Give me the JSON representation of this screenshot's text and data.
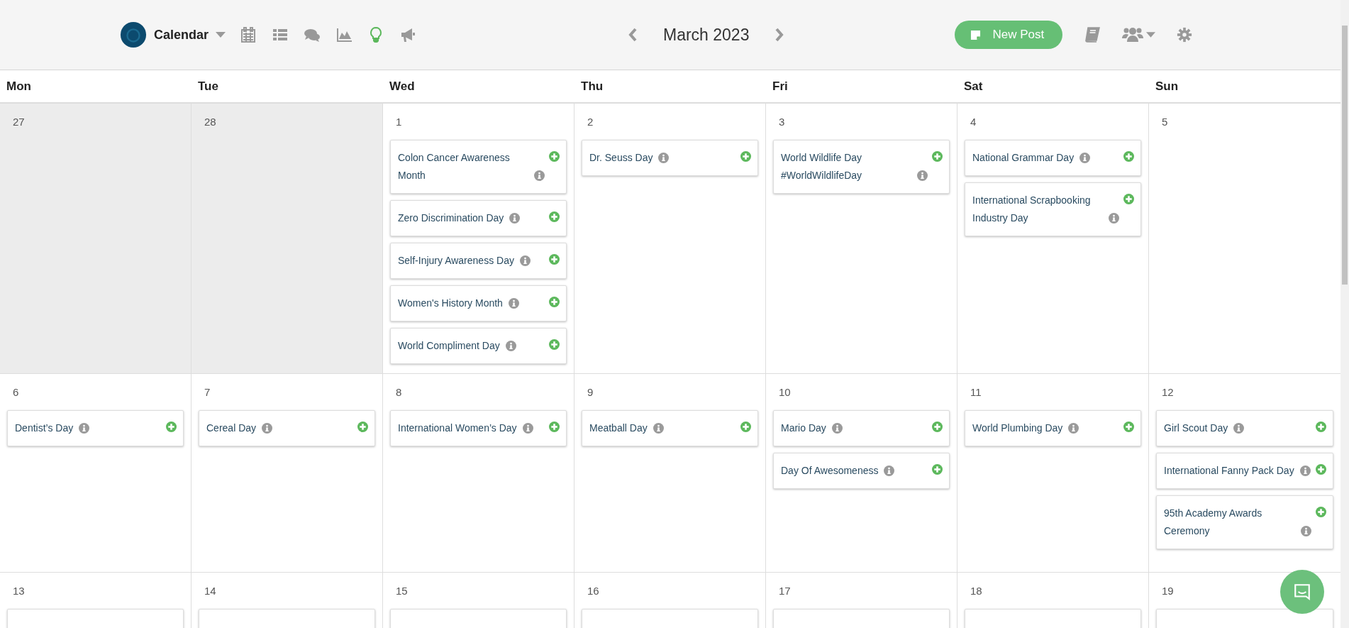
{
  "header": {
    "brand": {
      "label": "Calendar"
    },
    "views": [
      {
        "kind": "calendar",
        "selected": false
      },
      {
        "kind": "list",
        "selected": false
      },
      {
        "kind": "comments",
        "selected": false
      },
      {
        "kind": "chart",
        "selected": false
      },
      {
        "kind": "ideas",
        "selected": true
      },
      {
        "kind": "campaigns",
        "selected": false
      }
    ],
    "month": "March 2023",
    "new_post": "New Post"
  },
  "weekdays": [
    "Mon",
    "Tue",
    "Wed",
    "Thu",
    "Fri",
    "Sat",
    "Sun"
  ],
  "weeks": [
    [
      {
        "day": "27",
        "other_month": true
      },
      {
        "day": "28",
        "other_month": true
      },
      {
        "day": "1",
        "other_month": false,
        "events": [
          {
            "kind": "full",
            "title": "Colon Cancer Awareness Month"
          },
          {
            "kind": "full",
            "title": "Zero Discrimination Day"
          },
          {
            "kind": "full",
            "title": "Self-Injury Awareness Day"
          },
          {
            "kind": "full",
            "title": "Women's History Month"
          },
          {
            "kind": "full",
            "title": "World Compliment Day"
          }
        ]
      },
      {
        "day": "2",
        "other_month": false,
        "events": [
          {
            "kind": "full",
            "title": "Dr. Seuss Day"
          }
        ]
      },
      {
        "day": "3",
        "other_month": false,
        "events": [
          {
            "kind": "full",
            "title": "World Wildlife Day #WorldWildlifeDay"
          }
        ]
      },
      {
        "day": "4",
        "other_month": false,
        "events": [
          {
            "kind": "full",
            "title": "National Grammar Day"
          },
          {
            "kind": "full",
            "title": "International Scrapbooking Industry Day"
          }
        ]
      },
      {
        "day": "5",
        "other_month": false
      }
    ],
    [
      {
        "day": "6",
        "other_month": false,
        "events": [
          {
            "kind": "full",
            "title": "Dentist’s Day"
          }
        ]
      },
      {
        "day": "7",
        "other_month": false,
        "events": [
          {
            "kind": "full",
            "title": "Cereal Day"
          }
        ]
      },
      {
        "day": "8",
        "other_month": false,
        "events": [
          {
            "kind": "full",
            "title": "International Women’s Day"
          }
        ]
      },
      {
        "day": "9",
        "other_month": false,
        "events": [
          {
            "kind": "full",
            "title": "Meatball Day"
          }
        ]
      },
      {
        "day": "10",
        "other_month": false,
        "events": [
          {
            "kind": "full",
            "title": "Mario Day"
          },
          {
            "kind": "full",
            "title": "Day Of Awesomeness"
          }
        ]
      },
      {
        "day": "11",
        "other_month": false,
        "events": [
          {
            "kind": "full",
            "title": "World Plumbing Day"
          }
        ]
      },
      {
        "day": "12",
        "other_month": false,
        "events": [
          {
            "kind": "full",
            "title": "Girl Scout Day"
          },
          {
            "kind": "full",
            "title": "International Fanny Pack Day"
          },
          {
            "kind": "full",
            "title": "95th Academy Awards Ceremony"
          }
        ]
      }
    ],
    [
      {
        "day": "13",
        "other_month": false,
        "events": [
          {
            "kind": "cut"
          }
        ]
      },
      {
        "day": "14",
        "other_month": false,
        "events": [
          {
            "kind": "cut"
          }
        ]
      },
      {
        "day": "15",
        "other_month": false,
        "events": [
          {
            "kind": "cut"
          }
        ]
      },
      {
        "day": "16",
        "other_month": false,
        "events": [
          {
            "kind": "cut"
          }
        ]
      },
      {
        "day": "17",
        "other_month": false,
        "events": [
          {
            "kind": "cut"
          }
        ]
      },
      {
        "day": "18",
        "other_month": false,
        "events": [
          {
            "kind": "cut"
          }
        ]
      },
      {
        "day": "19",
        "other_month": false,
        "events": [
          {
            "kind": "cut"
          }
        ]
      }
    ]
  ]
}
